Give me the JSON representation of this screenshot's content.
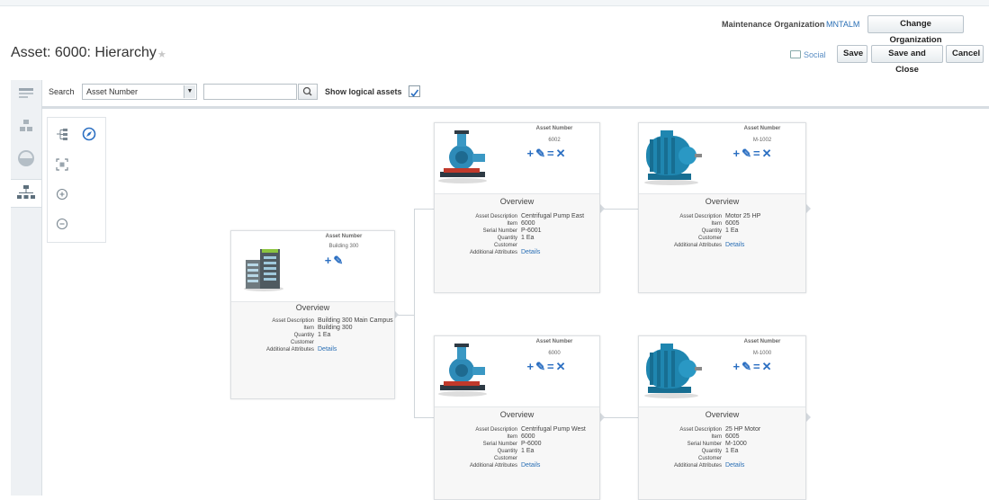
{
  "header": {
    "maintenance_org_label": "Maintenance Organization",
    "maintenance_org_value": "MNTALM",
    "change_org_label": "Change Organization",
    "title": "Asset: 6000: Hierarchy",
    "social_label": "Social",
    "save_label": "Save",
    "save_close_label": "Save and Close",
    "cancel_label": "Cancel"
  },
  "toolbar": {
    "search_label": "Search",
    "search_field_value": "Asset Number",
    "search_input_value": "",
    "show_logical_label": "Show logical assets",
    "show_logical_checked": true
  },
  "labels": {
    "asset_number": "Asset Number",
    "overview": "Overview",
    "asset_description": "Asset Description",
    "item": "Item",
    "serial_number": "Serial Number",
    "quantity": "Quantity",
    "customer": "Customer",
    "additional_attributes": "Additional Attributes",
    "details_link": "Details"
  },
  "nodes": {
    "root": {
      "asset_number": "Building 300",
      "description": "Building 300 Main Campus",
      "item": "Building 300",
      "quantity": "1 Ea",
      "customer": ""
    },
    "pump_east": {
      "asset_number": "6002",
      "description": "Centrifugal Pump East",
      "item": "6000",
      "serial": "P-6001",
      "quantity": "1 Ea",
      "customer": ""
    },
    "motor_1002": {
      "asset_number": "M-1002",
      "description": "Motor 25 HP",
      "item": "6005",
      "quantity": "1 Ea",
      "customer": ""
    },
    "pump_west": {
      "asset_number": "6000",
      "description": "Centrifugal Pump West",
      "item": "6000",
      "serial": "P-6000",
      "quantity": "1 Ea",
      "customer": ""
    },
    "motor_1000": {
      "asset_number": "M-1000",
      "description": "25 HP Motor",
      "item": "6005",
      "serial": "M-1000",
      "quantity": "1 Ea",
      "customer": ""
    }
  },
  "colors": {
    "accent": "#2b6fc2",
    "link": "#2a6fb5",
    "motor": "#1f86b0"
  }
}
